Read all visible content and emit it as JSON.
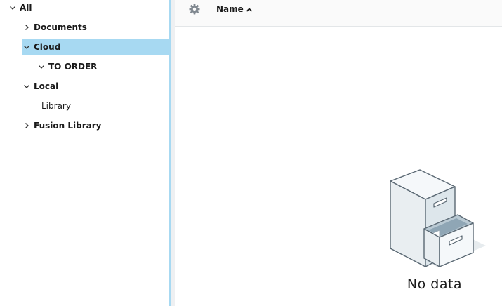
{
  "tree": {
    "items": [
      {
        "label": "All",
        "state": "expanded"
      },
      {
        "label": "Documents",
        "state": "collapsed"
      },
      {
        "label": "Cloud",
        "state": "expanded",
        "selected": true
      },
      {
        "label": "TO ORDER",
        "state": "expanded"
      },
      {
        "label": "Local",
        "state": "expanded"
      },
      {
        "label": "Library",
        "state": "leaf"
      },
      {
        "label": "Fusion Library",
        "state": "collapsed"
      }
    ]
  },
  "header": {
    "settings_icon": "gear-icon",
    "column_name": "Name",
    "sort_icon": "chevron-up-icon"
  },
  "empty_state": {
    "icon": "file-cabinet-icon",
    "message": "No data"
  },
  "colors": {
    "selection": "#a7d9f2",
    "splitter": "#a7d9f2",
    "header_bg": "#fafafa"
  }
}
